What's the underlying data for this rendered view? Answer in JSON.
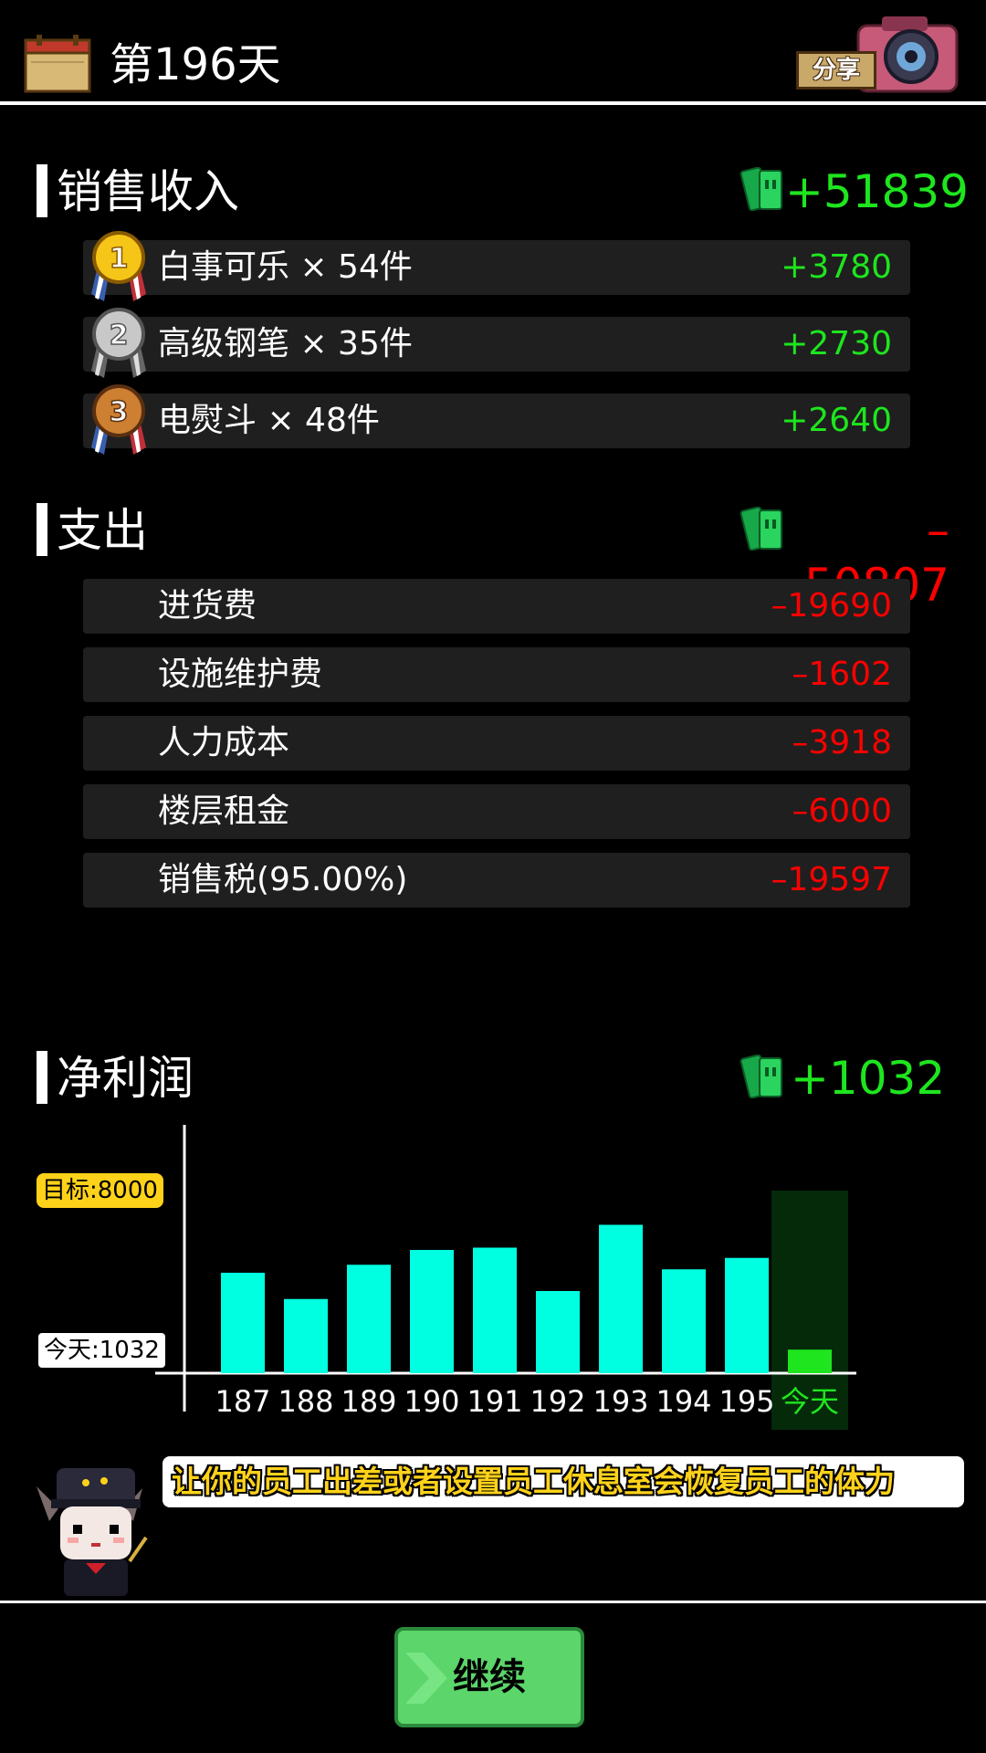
{
  "header": {
    "day_label": "第196天",
    "share_label": "分享"
  },
  "income": {
    "title": "销售收入",
    "total": "+51839",
    "items": [
      {
        "rank": "1",
        "label": "白事可乐 × 54件",
        "value": "+3780"
      },
      {
        "rank": "2",
        "label": "高级钢笔 × 35件",
        "value": "+2730"
      },
      {
        "rank": "3",
        "label": "电熨斗 × 48件",
        "value": "+2640"
      }
    ]
  },
  "expense": {
    "title": "支出",
    "total": "–50807",
    "items": [
      {
        "label": "进货费",
        "value": "–19690"
      },
      {
        "label": "设施维护费",
        "value": "–1602"
      },
      {
        "label": "人力成本",
        "value": "–3918"
      },
      {
        "label": "楼层租金",
        "value": "–6000"
      },
      {
        "label": "销售税(95.00%)",
        "value": "–19597"
      }
    ]
  },
  "profit": {
    "title": "净利润",
    "total": "+1032"
  },
  "chart_data": {
    "type": "bar",
    "categories": [
      "187",
      "188",
      "189",
      "190",
      "191",
      "192",
      "193",
      "194",
      "195",
      "今天"
    ],
    "values": [
      4400,
      3250,
      4750,
      5400,
      5500,
      3600,
      6500,
      4550,
      5050,
      1032
    ],
    "target_label": "目标:8000",
    "today_label": "今天:1032",
    "target": 8000,
    "ylim": [
      0,
      8000
    ],
    "bar_color": "#00ffe1",
    "today_color": "#1ee51e"
  },
  "tip": {
    "text": "让你的员工出差或者设置员工休息室会恢复员工的体力"
  },
  "footer": {
    "continue_label": "继续"
  },
  "colors": {
    "positive": "#1ee51e",
    "negative": "#ff0000",
    "row_bg": "#1f1f1f"
  }
}
